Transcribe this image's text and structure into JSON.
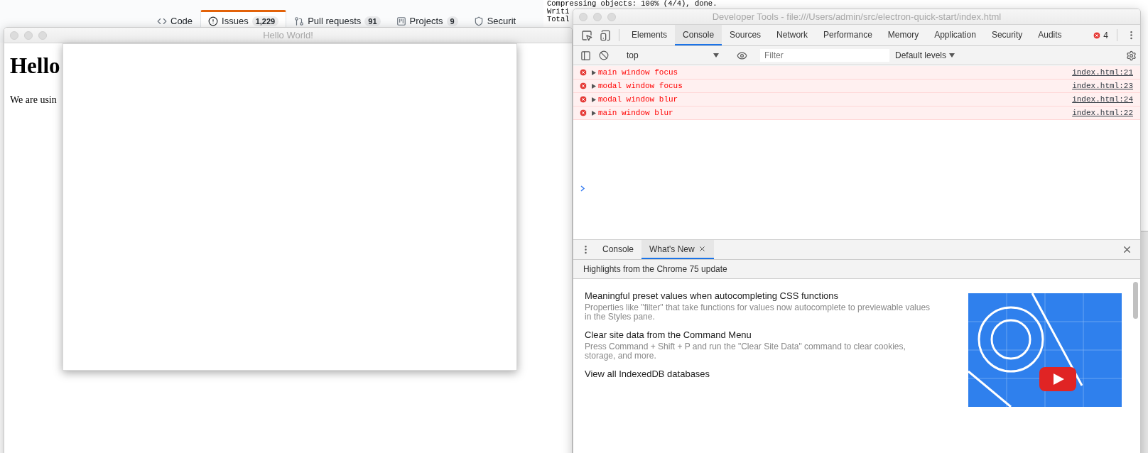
{
  "github_tabs": [
    {
      "label": "Code",
      "selected": false
    },
    {
      "label": "Issues",
      "counter": "1,229",
      "selected": true
    },
    {
      "label": "Pull requests",
      "counter": "91",
      "selected": false
    },
    {
      "label": "Projects",
      "counter": "9",
      "selected": false
    },
    {
      "label": "Securit",
      "selected": false
    }
  ],
  "terminal_lines": [
    "Compressing objects: 100% (4/4), done.",
    "Writi",
    "Total"
  ],
  "main_window": {
    "title": "Hello World!",
    "heading": "Hello",
    "paragraph": "We are usin"
  },
  "devtools": {
    "title": "Developer Tools - file:///Users/admin/src/electron-quick-start/index.html",
    "tabs": [
      {
        "label": "Elements",
        "selected": false
      },
      {
        "label": "Console",
        "selected": true
      },
      {
        "label": "Sources",
        "selected": false
      },
      {
        "label": "Network",
        "selected": false
      },
      {
        "label": "Performance",
        "selected": false
      },
      {
        "label": "Memory",
        "selected": false
      },
      {
        "label": "Application",
        "selected": false
      },
      {
        "label": "Security",
        "selected": false
      },
      {
        "label": "Audits",
        "selected": false
      }
    ],
    "error_count": "4",
    "context": "top",
    "filter": {
      "placeholder": "Filter"
    },
    "levels": "Default levels",
    "messages": [
      {
        "kind": "error",
        "text": "main window focus",
        "source": "index.html:21"
      },
      {
        "kind": "error",
        "text": "modal window focus",
        "source": "index.html:23"
      },
      {
        "kind": "error",
        "text": "modal window blur",
        "source": "index.html:24"
      },
      {
        "kind": "error",
        "text": "main window blur",
        "source": "index.html:22"
      }
    ],
    "drawer_tabs": [
      {
        "label": "Console",
        "selected": false,
        "closable": false
      },
      {
        "label": "What's New",
        "selected": true,
        "closable": true
      }
    ],
    "highlights": "Highlights from the Chrome 75 update",
    "features": [
      {
        "title": "Meaningful preset values when autocompleting CSS functions",
        "description": "Properties like \"filter\" that take functions for values now autocomplete to previewable values in the Styles pane."
      },
      {
        "title": "Clear site data from the Command Menu",
        "description": "Press Command + Shift + P and run the \"Clear Site Data\" command to clear cookies, storage, and more."
      },
      {
        "title": "View all IndexedDB databases"
      }
    ]
  }
}
